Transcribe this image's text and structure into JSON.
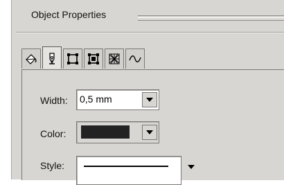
{
  "panel": {
    "title": "Object Properties"
  },
  "tabs": [
    {
      "icon": "fill-bucket-icon",
      "active": false
    },
    {
      "icon": "pen-nib-icon",
      "active": true
    },
    {
      "icon": "square-nodes-icon",
      "active": false
    },
    {
      "icon": "frame-nodes-icon",
      "active": false
    },
    {
      "icon": "mesh-icon",
      "active": false
    },
    {
      "icon": "wave-icon",
      "active": false
    }
  ],
  "fields": {
    "width": {
      "label": "Width:",
      "value": "0,5 mm"
    },
    "color": {
      "label": "Color:",
      "value_color": "#222222"
    },
    "style": {
      "label": "Style:"
    }
  }
}
